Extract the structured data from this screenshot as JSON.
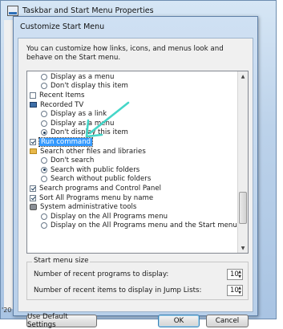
{
  "outer_window": {
    "title": "Taskbar and Start Menu Properties",
    "cut_text": "'20"
  },
  "dialog": {
    "title": "Customize Start Menu",
    "intro": "You can customize how links, icons, and menus look and behave on the Start menu.",
    "list_items": [
      {
        "type": "radio",
        "level": 1,
        "checked": false,
        "label": "Display as a menu",
        "icon": null
      },
      {
        "type": "radio",
        "level": 1,
        "checked": false,
        "label": "Don't display this item",
        "icon": null
      },
      {
        "type": "checkbox",
        "level": 0,
        "checked": false,
        "label": "Recent Items",
        "icon": null
      },
      {
        "type": "header",
        "level": 0,
        "checked": false,
        "label": "Recorded TV",
        "icon": "tv-icon"
      },
      {
        "type": "radio",
        "level": 1,
        "checked": false,
        "label": "Display as a link",
        "icon": null
      },
      {
        "type": "radio",
        "level": 1,
        "checked": false,
        "label": "Display as a menu",
        "icon": null
      },
      {
        "type": "radio",
        "level": 1,
        "checked": true,
        "label": "Don't display this item",
        "icon": null
      },
      {
        "type": "checkbox",
        "level": 0,
        "checked": true,
        "label": "Run command",
        "icon": null,
        "selected": true
      },
      {
        "type": "header",
        "level": 0,
        "checked": false,
        "label": "Search other files and libraries",
        "icon": "folder-icon"
      },
      {
        "type": "radio",
        "level": 1,
        "checked": false,
        "label": "Don't search",
        "icon": null
      },
      {
        "type": "radio",
        "level": 1,
        "checked": true,
        "label": "Search with public folders",
        "icon": null
      },
      {
        "type": "radio",
        "level": 1,
        "checked": false,
        "label": "Search without public folders",
        "icon": null
      },
      {
        "type": "checkbox",
        "level": 0,
        "checked": true,
        "label": "Search programs and Control Panel",
        "icon": null
      },
      {
        "type": "checkbox",
        "level": 0,
        "checked": true,
        "label": "Sort All Programs menu by name",
        "icon": null
      },
      {
        "type": "header",
        "level": 0,
        "checked": false,
        "label": "System administrative tools",
        "icon": "tools-icon"
      },
      {
        "type": "radio",
        "level": 1,
        "checked": false,
        "label": "Display on the All Programs menu",
        "icon": null
      },
      {
        "type": "radio",
        "level": 1,
        "checked": false,
        "label": "Display on the All Programs menu and the Start menu",
        "icon": null
      }
    ],
    "start_menu_size": {
      "label": "Start menu size",
      "recent_programs_label": "Number of recent programs to display:",
      "recent_programs_value": "10",
      "jump_list_label": "Number of recent items to display in Jump Lists:",
      "jump_list_value": "10"
    },
    "buttons": {
      "defaults": "Use Default Settings",
      "ok": "OK",
      "cancel": "Cancel"
    }
  },
  "colors": {
    "selection": "#3399ff",
    "annotation_arrow": "#45d6c8"
  }
}
